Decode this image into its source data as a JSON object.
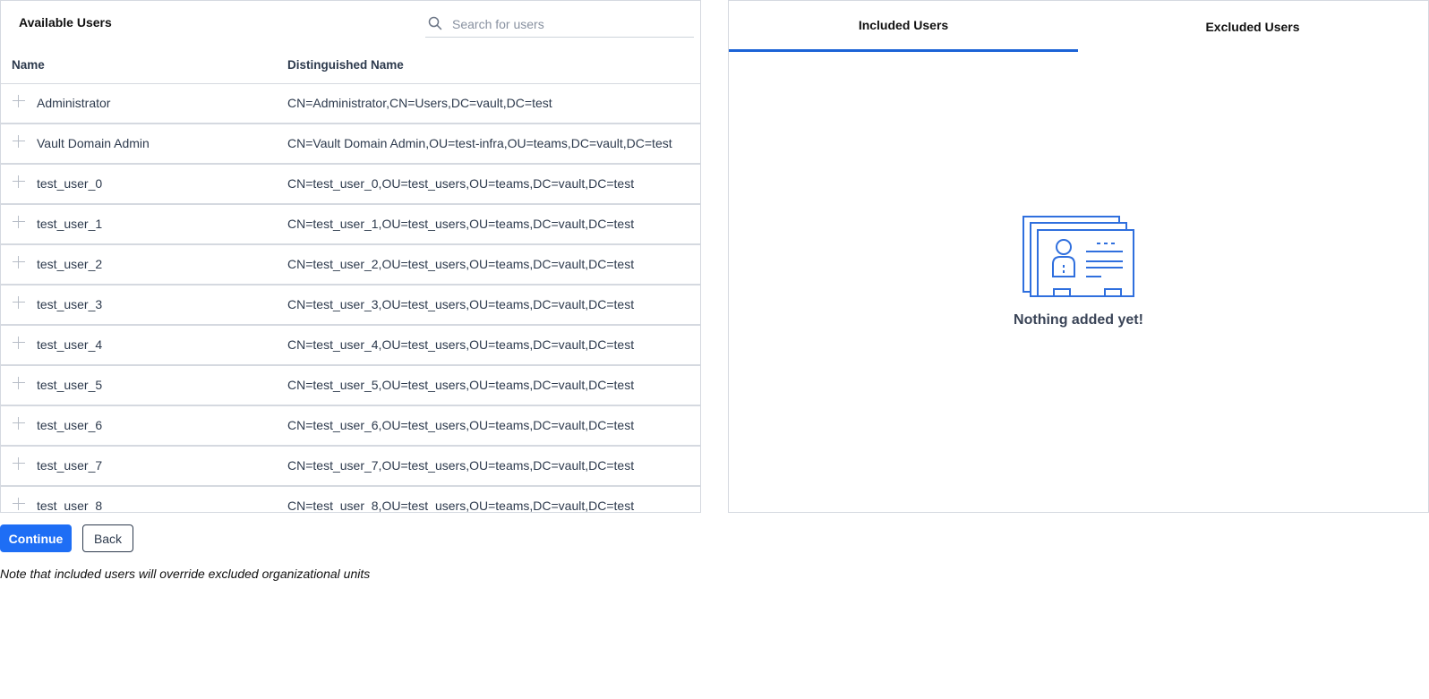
{
  "available": {
    "title": "Available Users",
    "search_placeholder": "Search for users",
    "columns": {
      "name": "Name",
      "dn": "Distinguished Name"
    },
    "rows": [
      {
        "name": "Administrator",
        "dn": "CN=Administrator,CN=Users,DC=vault,DC=test"
      },
      {
        "name": "Vault Domain Admin",
        "dn": "CN=Vault Domain Admin,OU=test-infra,OU=teams,DC=vault,DC=test"
      },
      {
        "name": "test_user_0",
        "dn": "CN=test_user_0,OU=test_users,OU=teams,DC=vault,DC=test"
      },
      {
        "name": "test_user_1",
        "dn": "CN=test_user_1,OU=test_users,OU=teams,DC=vault,DC=test"
      },
      {
        "name": "test_user_2",
        "dn": "CN=test_user_2,OU=test_users,OU=teams,DC=vault,DC=test"
      },
      {
        "name": "test_user_3",
        "dn": "CN=test_user_3,OU=test_users,OU=teams,DC=vault,DC=test"
      },
      {
        "name": "test_user_4",
        "dn": "CN=test_user_4,OU=test_users,OU=teams,DC=vault,DC=test"
      },
      {
        "name": "test_user_5",
        "dn": "CN=test_user_5,OU=test_users,OU=teams,DC=vault,DC=test"
      },
      {
        "name": "test_user_6",
        "dn": "CN=test_user_6,OU=test_users,OU=teams,DC=vault,DC=test"
      },
      {
        "name": "test_user_7",
        "dn": "CN=test_user_7,OU=test_users,OU=teams,DC=vault,DC=test"
      },
      {
        "name": "test_user_8",
        "dn": "CN=test_user_8,OU=test_users,OU=teams,DC=vault,DC=test"
      }
    ]
  },
  "selection": {
    "tabs": [
      {
        "label": "Included Users",
        "active": true
      },
      {
        "label": "Excluded Users",
        "active": false
      }
    ],
    "empty_text": "Nothing added yet!",
    "empty_icon": "user-cards-icon"
  },
  "actions": {
    "continue_label": "Continue",
    "back_label": "Back"
  },
  "note": "Note that included users will override excluded organizational units",
  "colors": {
    "accent": "#1e6ef5",
    "tab_underline": "#1b63d6",
    "text": "#2d3a4d",
    "border": "#d5d9e0"
  }
}
